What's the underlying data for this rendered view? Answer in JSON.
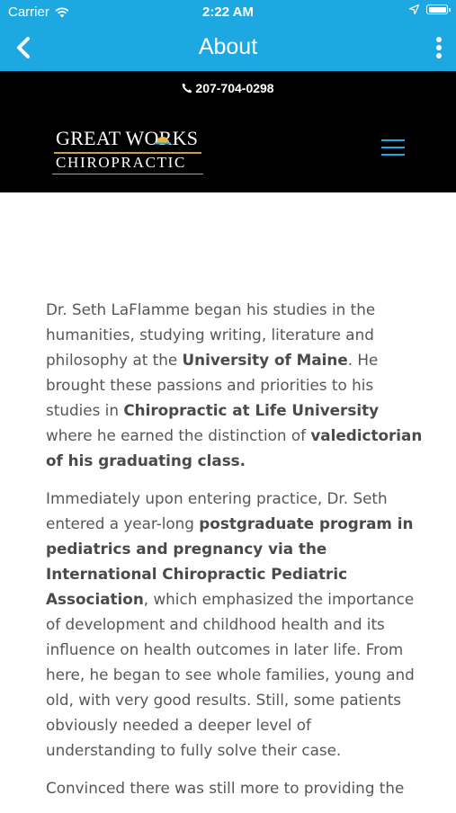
{
  "status_bar": {
    "carrier": "Carrier",
    "time": "2:22 AM"
  },
  "nav": {
    "title": "About"
  },
  "header": {
    "phone": "207-704-0298",
    "logo_line1": "GREAT WORKS",
    "logo_line2": "CHIROPRACTIC"
  },
  "content": {
    "p1": [
      "Dr. Seth LaFlamme began his studies in the humanities, studying writing, literature and philosophy at the ",
      "University of Maine",
      ". He brought these passions and priorities to his studies in ",
      "Chiropractic at Life University",
      " where he earned the distinction of ",
      "valedictorian of his graduating class."
    ],
    "p2": [
      "Immediately upon entering practice, Dr. Seth entered a year-long ",
      "postgraduate program in pediatrics and pregnancy via the International Chiropractic Pediatric Association",
      ", which emphasized the importance of development and childhood health and its influence on health outcomes in later life. From here, he began to see whole families, young and old, with very good results. Still, some patients obviously needed a deeper level of understanding to fully solve their case."
    ],
    "p3": "Convinced there was still more to providing the"
  },
  "colors": {
    "accent": "#1ea8e2",
    "header_bg": "#000000",
    "logo_gold": "#c9a03a",
    "body_text": "#575757"
  },
  "icons": {
    "back": "chevron-left-icon",
    "more": "vertical-ellipsis-icon",
    "menu": "hamburger-menu-icon",
    "phone": "phone-icon",
    "wifi": "wifi-icon",
    "location": "location-arrow-icon",
    "battery": "battery-icon"
  }
}
